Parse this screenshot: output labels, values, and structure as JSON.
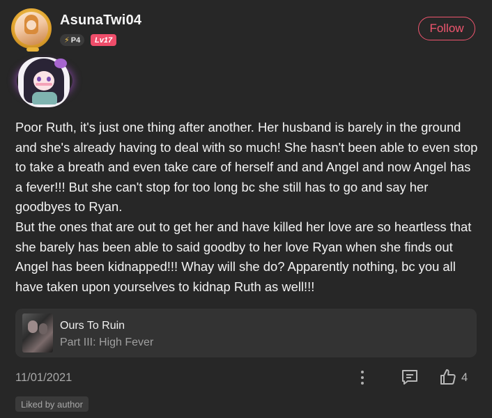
{
  "author": {
    "username": "AsunaTwi04",
    "power_badge": "P4",
    "level_badge": "Lv17"
  },
  "follow_button": {
    "label": "Follow"
  },
  "post": {
    "paragraph_1": "Poor Ruth, it's just one thing after another. Her husband is barely in the ground and she's already having to deal with so much! She hasn't been able to even stop to take a breath and even take care of herself and and Angel and now Angel has a fever!!! But she can't stop for too long bc she still has to go and say her goodbyes to Ryan.",
    "paragraph_2": "But the ones that are out to get her and have killed her love are so heartless that she barely has been able to said goodby to her love Ryan when she finds out Angel has been kidnapped!!! Whay will she do? Apparently nothing, bc you all have taken upon yourselves to kidnap Ruth as well!!!"
  },
  "story": {
    "title": "Ours To Ruin",
    "part": "Part III: High Fever"
  },
  "footer": {
    "date": "11/01/2021",
    "like_count": "4",
    "liked_by_label": "Liked by author"
  },
  "colors": {
    "accent": "#f0566f",
    "level_badge_bg": "#ef4d6a",
    "background": "#272727",
    "card_bg": "#333333"
  },
  "icons": {
    "more": "more-vertical-icon",
    "comment": "comment-icon",
    "like": "thumbs-up-icon",
    "power": "lightning-icon"
  }
}
